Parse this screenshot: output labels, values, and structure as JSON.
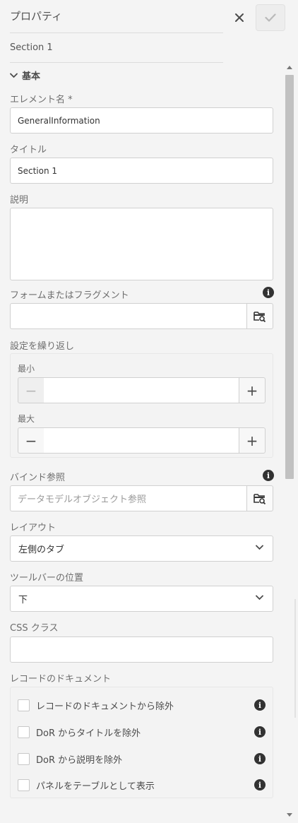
{
  "header": {
    "title": "プロパティ",
    "close_icon": "close-icon",
    "done_icon": "checkmark-icon"
  },
  "breadcrumb": "Section 1",
  "basic_section": {
    "label": "基本",
    "element_name": {
      "label": "エレメント名 *",
      "value": "GeneralInformation"
    },
    "title": {
      "label": "タイトル",
      "value": "Section 1"
    },
    "description": {
      "label": "説明",
      "value": ""
    },
    "fragment": {
      "label": "フォームまたはフラグメント",
      "value": ""
    },
    "repeat": {
      "label": "設定を繰り返し",
      "min_label": "最小",
      "max_label": "最大",
      "min_value": "",
      "max_value": "",
      "minus": "−",
      "plus": "+"
    },
    "bind_ref": {
      "label": "バインド参照",
      "placeholder": "データモデルオブジェクト参照"
    },
    "layout": {
      "label": "レイアウト",
      "value": "左側のタブ"
    },
    "toolbar_position": {
      "label": "ツールバーの位置",
      "value": "下"
    },
    "css_class": {
      "label": "CSS クラス",
      "value": ""
    },
    "dor": {
      "label": "レコードのドキュメント",
      "options": [
        {
          "label": "レコードのドキュメントから除外",
          "checked": false
        },
        {
          "label": "DoR からタイトルを除外",
          "checked": false
        },
        {
          "label": "DoR から説明を除外",
          "checked": false
        },
        {
          "label": "パネルをテーブルとして表示",
          "checked": false
        }
      ]
    }
  },
  "info_glyph": "i"
}
